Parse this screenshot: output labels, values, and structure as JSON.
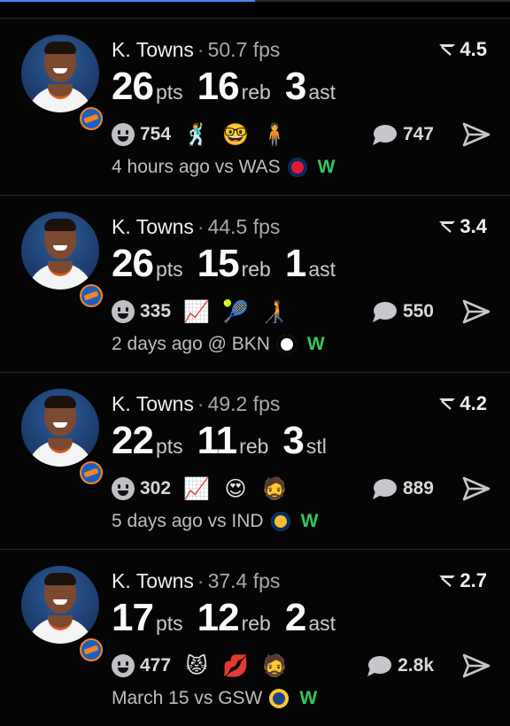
{
  "feed": [
    {
      "player": "K. Towns",
      "sep": "·",
      "fps": "50.7 fps",
      "rating": "4.5",
      "stats": [
        {
          "value": "26",
          "unit": "pts"
        },
        {
          "value": "16",
          "unit": "reb"
        },
        {
          "value": "3",
          "unit": "ast"
        }
      ],
      "likes": "754",
      "emojis": [
        "🕺",
        "🤓",
        "🧍"
      ],
      "comments": "747",
      "when": "4 hours ago vs WAS",
      "team_color": "#e31837",
      "team_accent": "#002b5c",
      "result": "W"
    },
    {
      "player": "K. Towns",
      "sep": "·",
      "fps": "44.5 fps",
      "rating": "3.4",
      "stats": [
        {
          "value": "26",
          "unit": "pts"
        },
        {
          "value": "15",
          "unit": "reb"
        },
        {
          "value": "1",
          "unit": "ast"
        }
      ],
      "likes": "335",
      "emojis": [
        "📈",
        "🎾",
        "🧑‍🦯"
      ],
      "comments": "550",
      "when": "2 days ago @ BKN",
      "team_color": "#ffffff",
      "team_accent": "#000000",
      "result": "W"
    },
    {
      "player": "K. Towns",
      "sep": "·",
      "fps": "49.2 fps",
      "rating": "4.2",
      "stats": [
        {
          "value": "22",
          "unit": "pts"
        },
        {
          "value": "11",
          "unit": "reb"
        },
        {
          "value": "3",
          "unit": "stl"
        }
      ],
      "likes": "302",
      "emojis": [
        "📈",
        "😍",
        "🧔"
      ],
      "comments": "889",
      "when": "5 days ago vs IND",
      "team_color": "#fdbb30",
      "team_accent": "#002d62",
      "result": "W"
    },
    {
      "player": "K. Towns",
      "sep": "·",
      "fps": "37.4 fps",
      "rating": "2.7",
      "stats": [
        {
          "value": "17",
          "unit": "pts"
        },
        {
          "value": "12",
          "unit": "reb"
        },
        {
          "value": "2",
          "unit": "ast"
        }
      ],
      "likes": "477",
      "emojis": [
        "😾",
        "💋",
        "🧔"
      ],
      "comments": "2.8k",
      "when": "March 15 vs GSW",
      "team_color": "#1d428a",
      "team_accent": "#ffc72c",
      "result": "W"
    }
  ],
  "colors": {
    "win": "#34c759",
    "progress": "#3d8bfd"
  }
}
